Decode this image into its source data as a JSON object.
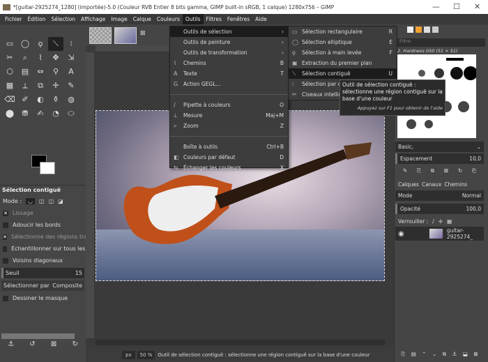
{
  "window": {
    "title": "*[guitar-2925274_1280] (importée)-5.0 (Couleur RVB Entier 8 bits gamma, GIMP built-in sRGB, 1 calque) 1280x756 – GIMP",
    "minimize": "—",
    "maximize": "☐",
    "close": "✕"
  },
  "menubar": [
    "Fichier",
    "Édition",
    "Sélection",
    "Affichage",
    "Image",
    "Calque",
    "Couleurs",
    "Outils",
    "Filtres",
    "Fenêtres",
    "Aide"
  ],
  "tools_menu": [
    {
      "label": "Outils de sélection",
      "shortcut": "›",
      "icon": ""
    },
    {
      "label": "Outils de peinture",
      "shortcut": "›",
      "icon": ""
    },
    {
      "label": "Outils de transformation",
      "shortcut": "›",
      "icon": ""
    },
    {
      "label": "Chemins",
      "shortcut": "B",
      "icon": "⌇"
    },
    {
      "label": "Texte",
      "shortcut": "T",
      "icon": "A"
    },
    {
      "label": "Action GEGL...",
      "shortcut": "",
      "icon": "G"
    },
    {
      "label": "Pipette à couleurs",
      "shortcut": "O",
      "icon": "/"
    },
    {
      "label": "Mesure",
      "shortcut": "Maj+M",
      "icon": "⟂"
    },
    {
      "label": "Zoom",
      "shortcut": "Z",
      "icon": "⌕"
    },
    {
      "label": "Boîte à outils",
      "shortcut": "Ctrl+B",
      "icon": ""
    },
    {
      "label": "Couleurs par défaut",
      "shortcut": "D",
      "icon": "◧"
    },
    {
      "label": "Échanger les couleurs",
      "shortcut": "X",
      "icon": "⇆"
    }
  ],
  "selection_submenu": [
    {
      "label": "Sélection rectangulaire",
      "shortcut": "R",
      "icon": "▭"
    },
    {
      "label": "Sélection elliptique",
      "shortcut": "E",
      "icon": "◯"
    },
    {
      "label": "Sélection à main levée",
      "shortcut": "F",
      "icon": "ϙ"
    },
    {
      "label": "Extraction du premier plan",
      "shortcut": "",
      "icon": "▣"
    },
    {
      "label": "Sélection contiguë",
      "shortcut": "U",
      "icon": "⟍"
    },
    {
      "label": "Sélection par couleur",
      "shortcut": "",
      "icon": "⁝"
    },
    {
      "label": "Ciseaux intelligents",
      "shortcut": "",
      "icon": "✂"
    }
  ],
  "tooltip": {
    "text": "Outil de sélection contiguë : sélectionne une région contiguë sur la base d'une couleur",
    "hint": "Appuyez sur F1 pour obtenir de l'aide"
  },
  "tool_options": {
    "title": "Sélection contiguë",
    "mode_label": "Mode :",
    "checks": [
      {
        "label": "Lissage",
        "checked": true
      },
      {
        "label": "Adoucir les bords",
        "checked": false
      },
      {
        "label": "Sélectionne des régions transparentes",
        "checked": true
      },
      {
        "label": "Échantillonner sur tous les calques",
        "checked": false
      },
      {
        "label": "Voisins diagonaux",
        "checked": false
      }
    ],
    "threshold_label": "Seuil",
    "threshold_value": "15",
    "select_by_label": "Sélectionner par",
    "select_by_value": "Composite",
    "draw_mask_label": "Dessiner le masque"
  },
  "brushes": {
    "filter_placeholder": "Filtre",
    "brush_name": "2. Hardness 050 (51 × 51)",
    "preset": "Basic,",
    "spacing_label": "Espacement",
    "spacing_value": "10,0"
  },
  "layers": {
    "tabs": [
      "Calques",
      "Canaux",
      "Chemins"
    ],
    "mode_label": "Mode",
    "mode_value": "Normal",
    "opacity_label": "Opacité",
    "opacity_value": "100,0",
    "lock_label": "Verrouiller :",
    "layer_name": "guitar-2925274_"
  },
  "status": {
    "unit": "px",
    "zoom": "50 %",
    "message": "Outil de sélection contiguë : sélectionne une région contiguë sur la base d'une couleur"
  },
  "toolbox_icons": [
    "▭",
    "◯",
    "ϙ",
    "⟍",
    "⁝",
    "✂",
    "⌕",
    "⌇",
    "✥",
    "⇲",
    "⬡",
    "▤",
    "⇔",
    "⚲",
    "A",
    "▦",
    "⟂",
    "⧉",
    "✛",
    "✎",
    "⌫",
    "✐",
    "◐",
    "⚱",
    "◍",
    "⬤",
    "⛃",
    "✍",
    "◔",
    "⬭"
  ]
}
